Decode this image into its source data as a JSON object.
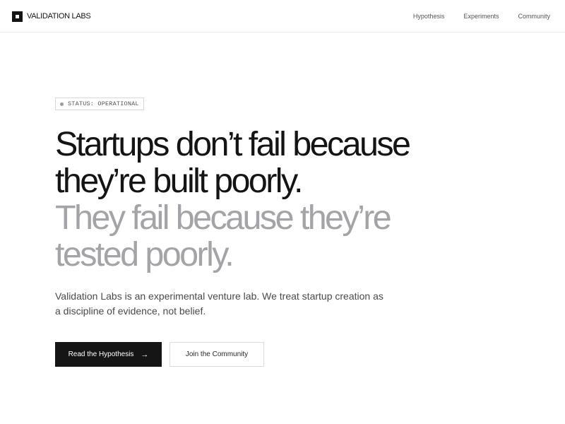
{
  "brand": {
    "name": "VALIDATION LABS"
  },
  "nav": {
    "links": [
      {
        "label": "Hypothesis"
      },
      {
        "label": "Experiments"
      },
      {
        "label": "Community"
      }
    ]
  },
  "status_badge": {
    "text": "STATUS: OPERATIONAL",
    "icon": "status-dot-icon"
  },
  "headline": {
    "line1": "Startups don’t fail because",
    "line2": "they’re built poorly.",
    "line3": "They fail because they’re",
    "line4": "tested poorly."
  },
  "lead": {
    "line1": "Validation Labs is an experimental venture lab. We treat startup creation as",
    "line2": "a discipline of evidence, not belief."
  },
  "cta": {
    "primary_label": "Read the Hypothesis",
    "primary_icon": "arrow-right-icon",
    "secondary_label": "Join the Community"
  },
  "colors": {
    "text_dark": "#141414",
    "text_muted": "#a3a3a8",
    "button_primary_bg": "#151515",
    "border": "#dcdcdc"
  }
}
